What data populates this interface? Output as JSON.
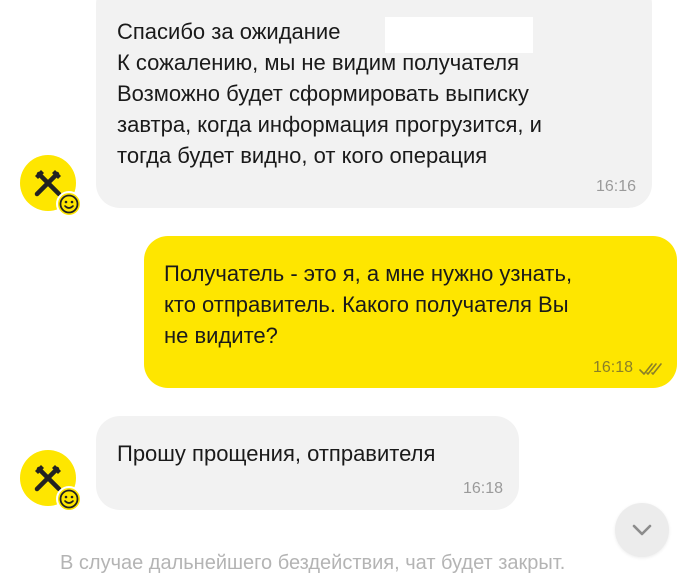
{
  "messages": [
    {
      "direction": "incoming",
      "lines": [
        "Спасибо за ожидание",
        "К сожалению, мы не видим получателя",
        "Возможно будет сформировать выписку",
        "завтра, когда информация прогрузится, и",
        "тогда будет видно, от кого операция"
      ],
      "time": "16:16"
    },
    {
      "direction": "outgoing",
      "lines": [
        "Получатель - это я, а мне нужно узнать,",
        "кто отправитель. Какого получателя Вы",
        "не видите?"
      ],
      "time": "16:18",
      "status": "read"
    },
    {
      "direction": "incoming",
      "lines": [
        "Прошу прощения, отправителя"
      ],
      "time": "16:18"
    }
  ],
  "footer_notice": "В случае дальнейшего бездействия, чат будет закрыт.",
  "colors": {
    "accent_yellow": "#fee600",
    "incoming_bubble": "#f2f2f2"
  },
  "icons": {
    "avatar": "raiffeisen-logo-icon",
    "badge": "smiley-icon",
    "read_status": "double-check-icon",
    "scroll": "chevron-down-icon"
  }
}
